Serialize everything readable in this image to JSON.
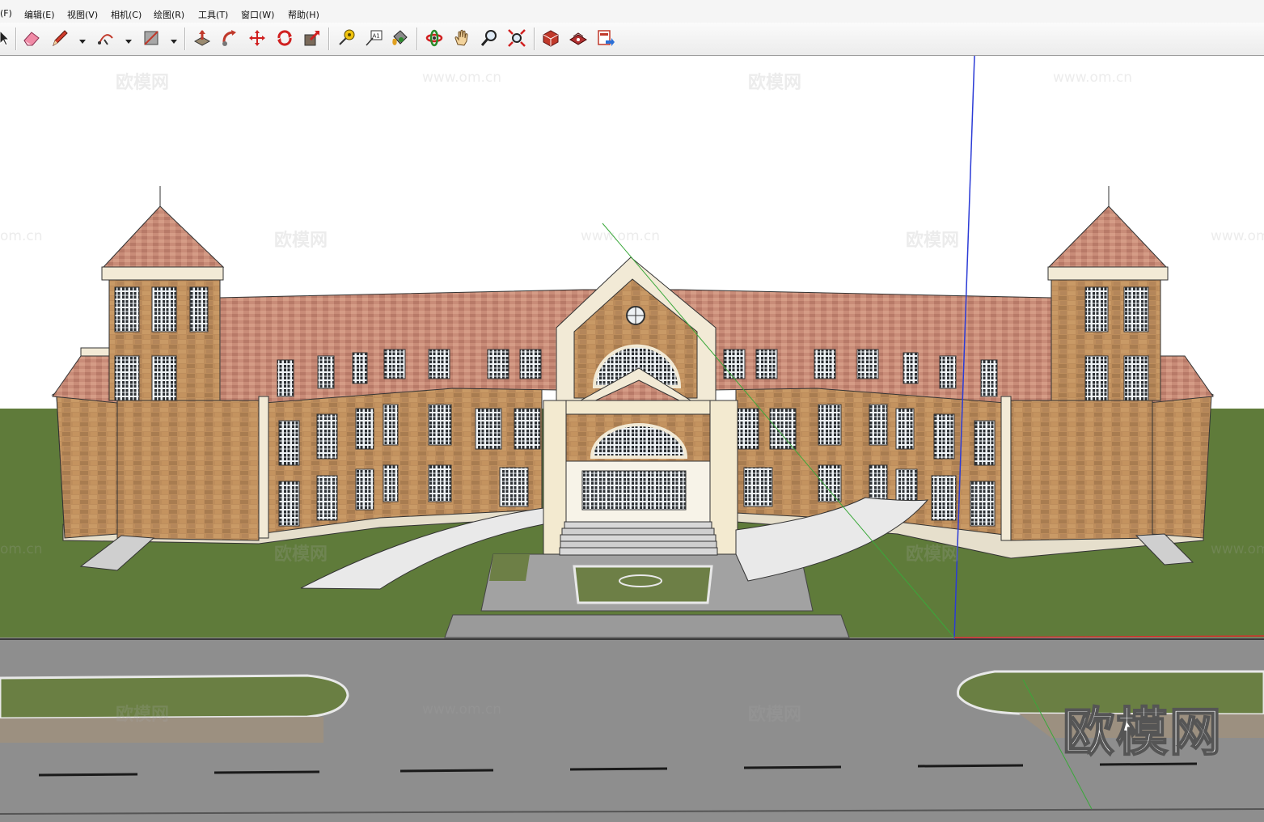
{
  "menu": {
    "file": "(F)",
    "edit": "编辑(E)",
    "view": "视图(V)",
    "camera": "相机(C)",
    "draw": "绘图(R)",
    "tools": "工具(T)",
    "window": "窗口(W)",
    "help": "帮助(H)"
  },
  "toolbar": {
    "tools": [
      "select-icon",
      "eraser-icon",
      "pencil-icon",
      "arc-icon",
      "rectangle-icon",
      "push-pull-icon",
      "follow-me-icon",
      "move-icon",
      "rotate-icon",
      "scale-icon",
      "tape-measure-icon",
      "text-icon",
      "paint-bucket-icon",
      "orbit-icon",
      "pan-icon",
      "zoom-icon",
      "zoom-extents-icon",
      "get-models-icon",
      "share-model-icon",
      "send-to-layout-icon"
    ],
    "text_tool_label": "A1"
  },
  "watermarks": {
    "brand": "欧模网",
    "url": "www.om.cn",
    "url_partial": "om.cn",
    "big": "欧模网"
  },
  "colors": {
    "sky": "#ffffff",
    "grass": "#5e7a3a",
    "road": "#8c8c8c",
    "brick": "#b88a5e",
    "roof": "#c98e7a",
    "trim": "#f2ead6",
    "blue_axis": "#2b3bd6",
    "green_axis": "#3aa83a",
    "red_axis": "#d63030"
  }
}
